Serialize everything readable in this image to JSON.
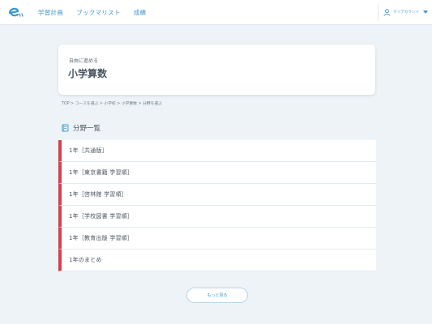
{
  "header": {
    "logo_icon": "e-logo-icon",
    "nav": [
      {
        "label": "学習計画"
      },
      {
        "label": "ブックマリスト"
      },
      {
        "label": "成績"
      }
    ],
    "account": {
      "label": "マイアカウント",
      "icon": "person-icon"
    }
  },
  "title_card": {
    "subtitle": "自由に進める",
    "title": "小学算数"
  },
  "breadcrumb": {
    "text": "TOP > コースを選ぶ > 小学校 > 小学算数 > 分野を選ぶ"
  },
  "section": {
    "icon": "book-icon",
    "title": "分野一覧"
  },
  "list": {
    "items": [
      {
        "label": "1年［共通版］"
      },
      {
        "label": "1年［東京書籍 学習順］"
      },
      {
        "label": "1年［啓林館 学習順］"
      },
      {
        "label": "1年［学校図書 学習順］"
      },
      {
        "label": "1年［教育出版 学習順］"
      },
      {
        "label": "1年のまとめ"
      }
    ]
  },
  "more_button": {
    "label": "もっと見る"
  },
  "colors": {
    "accent": "#3b97cf",
    "marker": "#d8404a",
    "background": "#eef3f7"
  }
}
